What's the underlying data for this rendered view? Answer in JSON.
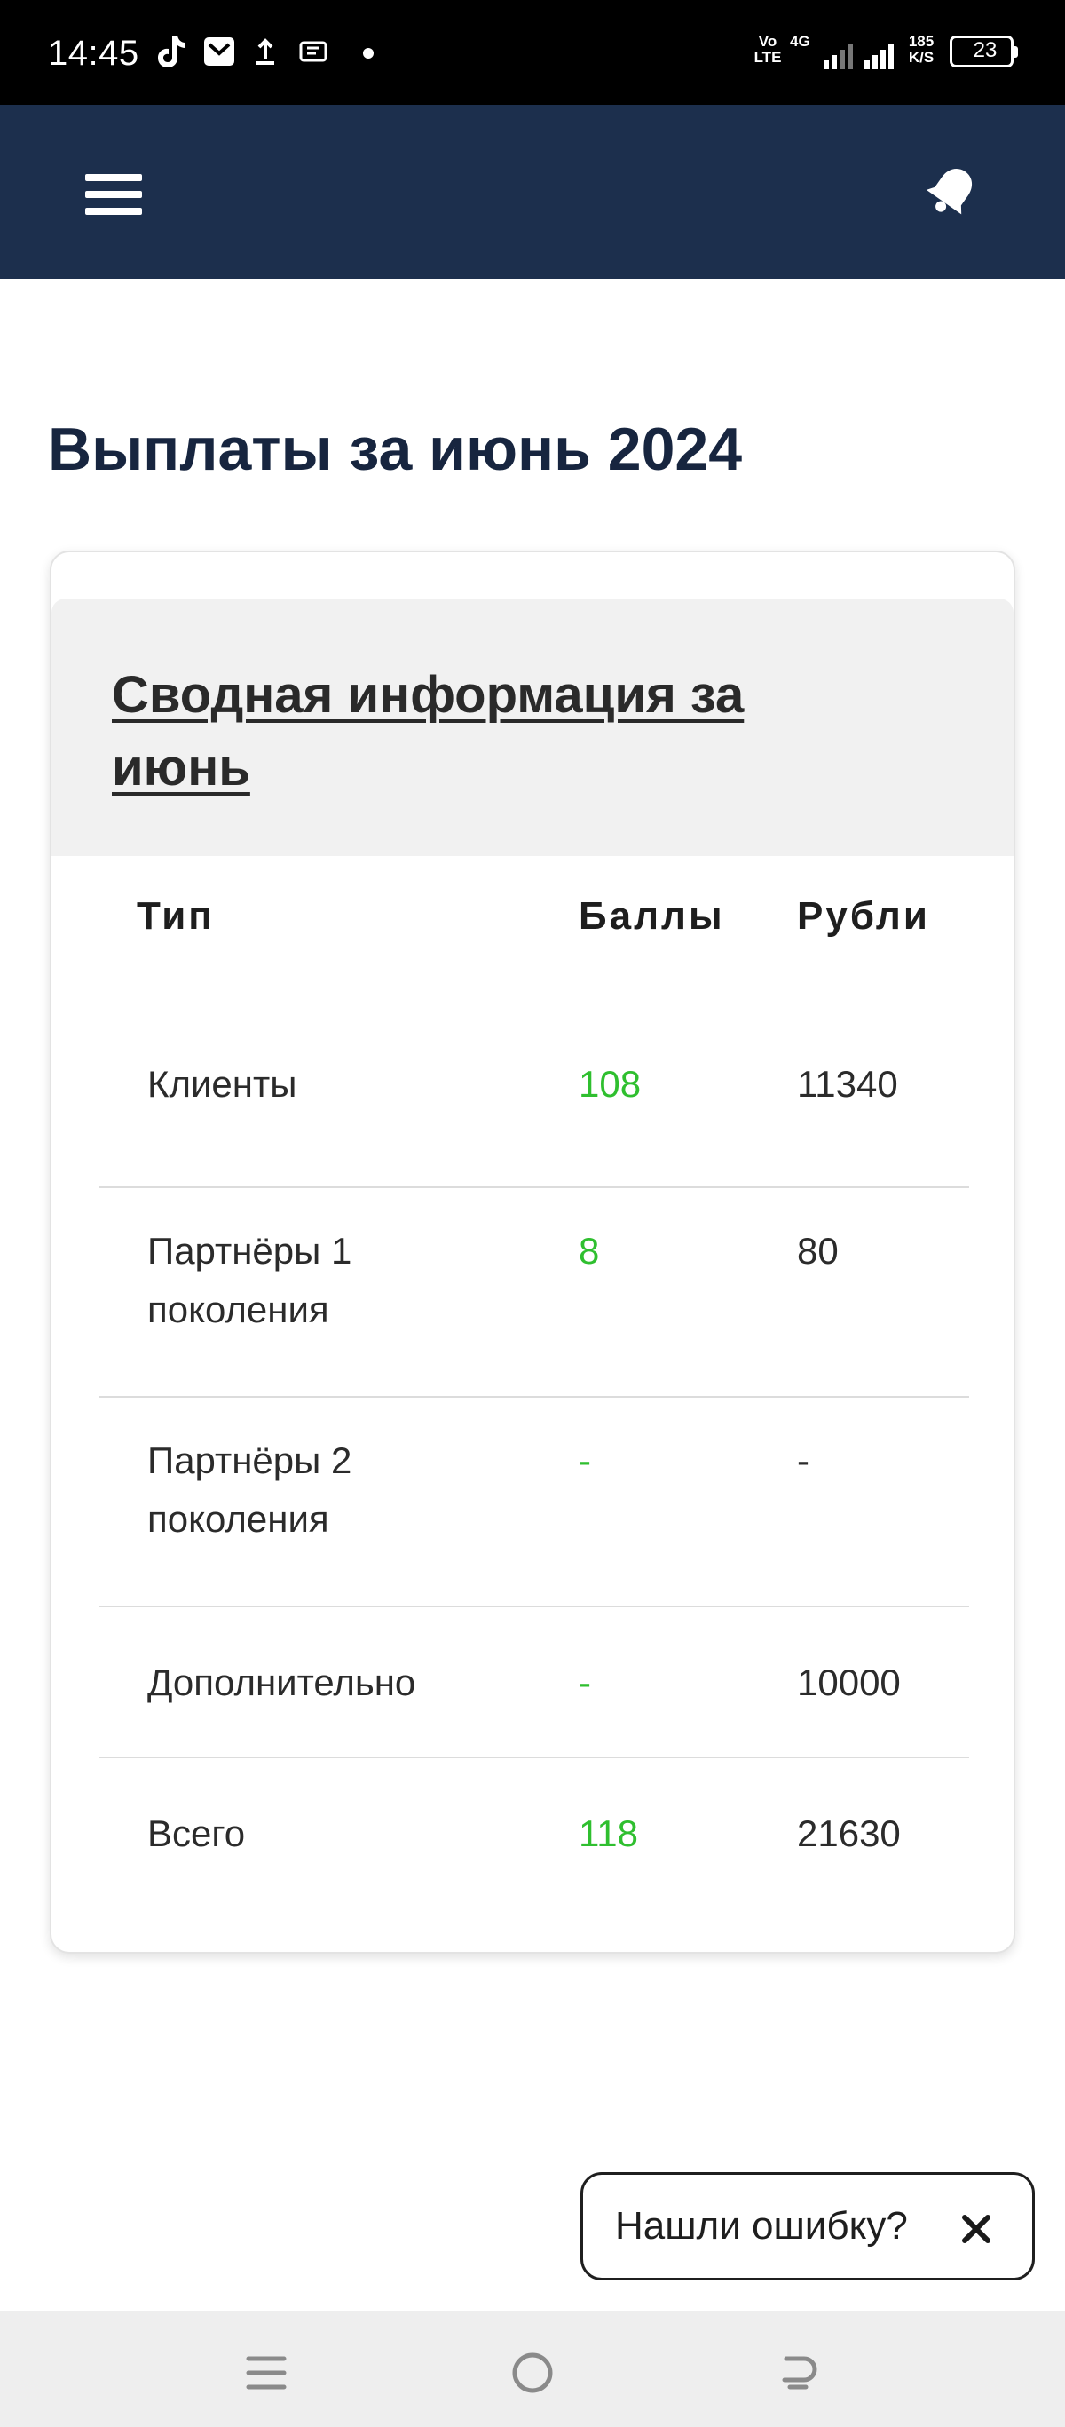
{
  "status_bar": {
    "time": "14:45",
    "volte_top": "Vo",
    "volte_bottom": "LTE",
    "network": "4G",
    "speed_value": "185",
    "speed_unit": "K/S",
    "battery": "23",
    "left_icons": [
      "tiktok-icon",
      "mail-icon",
      "upload-icon",
      "app-icon",
      "dot-icon"
    ]
  },
  "header": {
    "menu_icon": "hamburger-menu-icon",
    "bell_icon": "bell-icon",
    "color": "#1c2f4d"
  },
  "page": {
    "title": "Выплаты за июнь 2024"
  },
  "card": {
    "title": "Сводная информация за июнь",
    "columns": [
      "Тип",
      "Баллы",
      "Рубли"
    ],
    "rows": [
      {
        "type": "Клиенты",
        "points": "108",
        "rub": "11340"
      },
      {
        "type": "Партнёры 1 поколения",
        "points": "8",
        "rub": "80"
      },
      {
        "type": "Партнёры 2 поколения",
        "points": "-",
        "rub": "-"
      },
      {
        "type": "Дополнительно",
        "points": "-",
        "rub": "10000"
      },
      {
        "type": "Всего",
        "points": "118",
        "rub": "21630"
      }
    ],
    "points_color": "#2fbf2f"
  },
  "feedback": {
    "label": "Нашли ошибку?",
    "close_icon": "close-icon"
  },
  "nav_bar": {
    "icons": [
      "recent-apps-icon",
      "home-icon",
      "back-icon"
    ]
  }
}
